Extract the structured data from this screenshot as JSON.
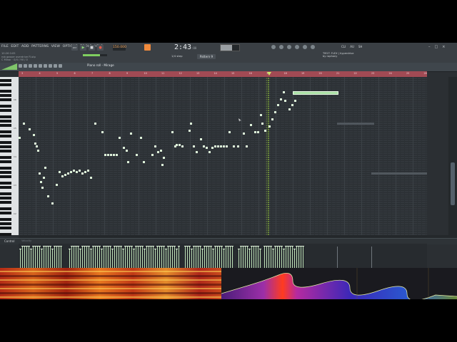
{
  "menu": [
    "FILE",
    "EDIT",
    "ADD",
    "PATTERNS",
    "VIEW",
    "OPTIONS",
    "TOOLS",
    "HELP"
  ],
  "project": {
    "name": "rob gasser overdrive FLstp",
    "info_line": "C Minor · 0/4 / 90 / 0",
    "label": "10:26 0:05 "
  },
  "transport": {
    "pat": "PAT",
    "song": "SONG",
    "bpm": "150.000",
    "time": "2:43",
    "time_sub": ":00",
    "step": "1/4 step",
    "pattern": "Pattern 9"
  },
  "hint": {
    "line1": "TM1T: FLEX | hyperdrive",
    "line2": "by raphony"
  },
  "toolbar_right": [
    "CLI",
    "AU",
    "SH"
  ],
  "piano_roll": {
    "title": "Piano roll - Mirage",
    "control_label": "Control",
    "control_sub": "Velocity"
  },
  "timeline_numbers": [
    "3",
    "4",
    "5",
    "6",
    "7",
    "8",
    "9",
    "10",
    "11",
    "12",
    "13",
    "14",
    "15",
    "16",
    "17",
    "18",
    "19",
    "20",
    "21",
    "22",
    "23",
    "24",
    "25",
    "26"
  ],
  "key_labels": [
    "C6",
    "C5",
    "C4",
    "C3",
    "C2"
  ],
  "colors": {
    "note": "#bfe8b8",
    "playhead": "#7aa334",
    "timeline": "#a14a54",
    "accent": "#f08a3c"
  },
  "icons": [
    "play-icon",
    "stop-icon",
    "record-icon",
    "metronome-icon",
    "snap-icon",
    "magnet-icon",
    "gear-icon"
  ]
}
